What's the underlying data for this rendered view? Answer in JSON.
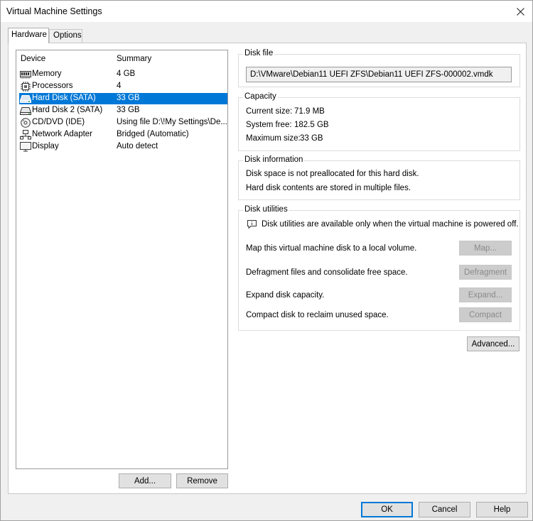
{
  "window": {
    "title": "Virtual Machine Settings"
  },
  "tabs": [
    {
      "label": "Hardware",
      "active": true
    },
    {
      "label": "Options",
      "active": false
    }
  ],
  "device_list": {
    "headers": {
      "device": "Device",
      "summary": "Summary"
    },
    "rows": [
      {
        "name": "Memory",
        "summary": "4 GB",
        "icon": "memory-icon",
        "selected": false
      },
      {
        "name": "Processors",
        "summary": "4",
        "icon": "processor-icon",
        "selected": false
      },
      {
        "name": "Hard Disk (SATA)",
        "summary": "33 GB",
        "icon": "hard-disk-icon",
        "selected": true
      },
      {
        "name": "Hard Disk 2 (SATA)",
        "summary": "33 GB",
        "icon": "hard-disk-icon",
        "selected": false
      },
      {
        "name": "CD/DVD (IDE)",
        "summary": "Using file D:\\!My Settings\\De...",
        "icon": "cd-dvd-icon",
        "selected": false
      },
      {
        "name": "Network Adapter",
        "summary": "Bridged (Automatic)",
        "icon": "network-adapter-icon",
        "selected": false
      },
      {
        "name": "Display",
        "summary": "Auto detect",
        "icon": "display-icon",
        "selected": false
      }
    ],
    "buttons": {
      "add": "Add...",
      "remove": "Remove"
    }
  },
  "disk_file": {
    "legend": "Disk file",
    "path": "D:\\VMware\\Debian11 UEFI ZFS\\Debian11 UEFI ZFS-000002.vmdk"
  },
  "capacity": {
    "legend": "Capacity",
    "current_size_label": "Current size:",
    "current_size_value": "71.9 MB",
    "system_free_label": "System free:",
    "system_free_value": "182.5 GB",
    "maximum_size_label": "Maximum size:",
    "maximum_size_value": "33 GB"
  },
  "disk_information": {
    "legend": "Disk information",
    "line1": "Disk space is not preallocated for this hard disk.",
    "line2": "Hard disk contents are stored in multiple files."
  },
  "disk_utilities": {
    "legend": "Disk utilities",
    "notice": "Disk utilities are available only when the virtual machine is powered off.",
    "rows": [
      {
        "text": "Map this virtual machine disk to a local volume.",
        "button": "Map..."
      },
      {
        "text": "Defragment files and consolidate free space.",
        "button": "Defragment"
      },
      {
        "text": "Expand disk capacity.",
        "button": "Expand..."
      },
      {
        "text": "Compact disk to reclaim unused space.",
        "button": "Compact"
      }
    ]
  },
  "advanced_button": "Advanced...",
  "footer": {
    "ok": "OK",
    "cancel": "Cancel",
    "help": "Help"
  },
  "colors": {
    "selection": "#0078d7",
    "window_bg": "#f0f0f0",
    "panel_bg": "#ffffff",
    "default_button_border": "#0078d7"
  }
}
